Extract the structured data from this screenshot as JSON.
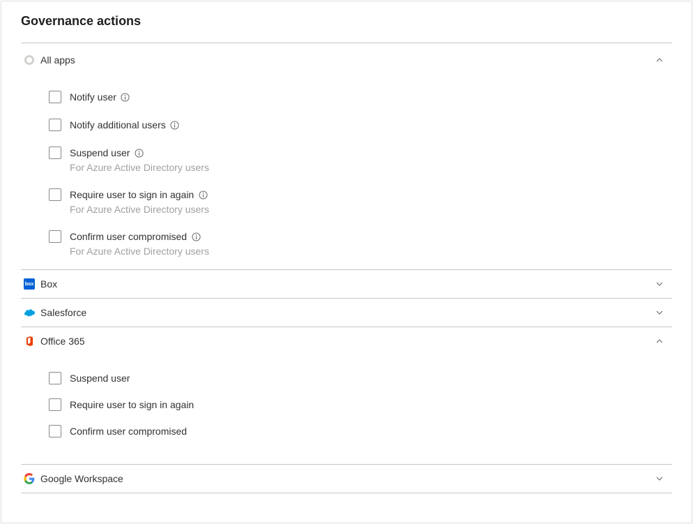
{
  "title": "Governance actions",
  "sections": {
    "allapps": {
      "name": "All apps",
      "expanded": true,
      "actions": [
        {
          "label": "Notify user",
          "info": true,
          "hint": ""
        },
        {
          "label": "Notify additional users",
          "info": true,
          "hint": ""
        },
        {
          "label": "Suspend user",
          "info": true,
          "hint": "For Azure Active Directory users"
        },
        {
          "label": "Require user to sign in again",
          "info": true,
          "hint": "For Azure Active Directory users"
        },
        {
          "label": "Confirm user compromised",
          "info": true,
          "hint": "For Azure Active Directory users"
        }
      ]
    },
    "box": {
      "name": "Box",
      "expanded": false
    },
    "salesforce": {
      "name": "Salesforce",
      "expanded": false
    },
    "office365": {
      "name": "Office 365",
      "expanded": true,
      "actions": [
        {
          "label": "Suspend user",
          "info": false,
          "hint": ""
        },
        {
          "label": "Require user to sign in again",
          "info": false,
          "hint": ""
        },
        {
          "label": "Confirm user compromised",
          "info": false,
          "hint": ""
        }
      ]
    },
    "googleworkspace": {
      "name": "Google Workspace",
      "expanded": false
    }
  }
}
